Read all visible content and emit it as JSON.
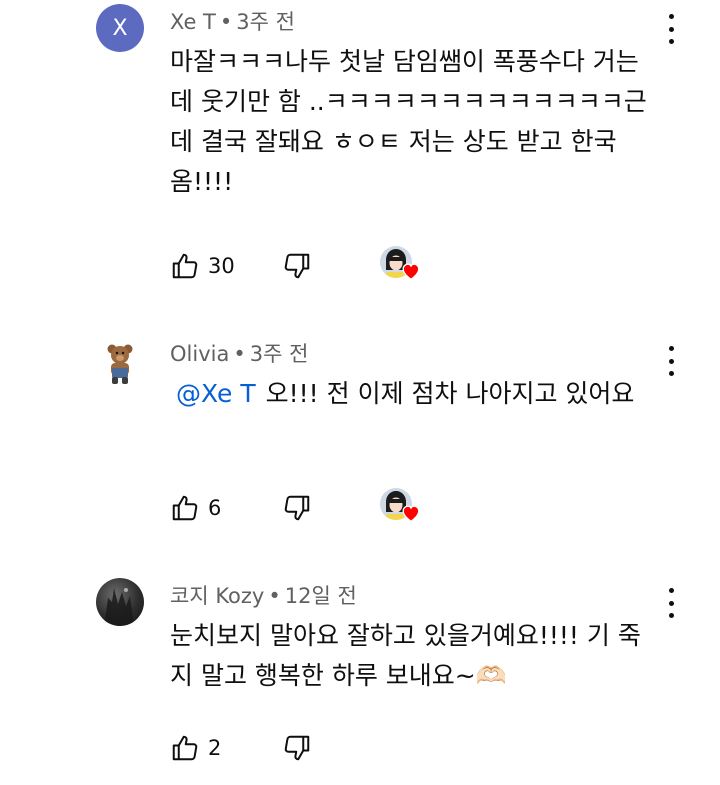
{
  "comments": [
    {
      "avatar_letter": "X",
      "author": "Xe T",
      "separator": "•",
      "time": "3주 전",
      "mention": "",
      "text": "마잘ㅋㅋㅋ나두 첫날 담임쌤이 폭풍수다 거는데 웃기만 함 ..ㅋㅋㅋㅋㅋㅋㅋㅋㅋㅋㅋㅋㅋ근데 결국 잘돼요 ㅎㅇㅌ 저는 상도 받고 한국 옴!!!!",
      "likes": "30",
      "creator_hearted": true
    },
    {
      "avatar_letter": "",
      "author": "Olivia",
      "separator": "•",
      "time": "3주 전",
      "mention": "@Xe T",
      "text": "오!!! 전 이제 점차 나아지고 있어요",
      "likes": "6",
      "creator_hearted": true
    },
    {
      "avatar_letter": "",
      "author": "코지 Kozy",
      "separator": "•",
      "time": "12일 전",
      "mention": "",
      "text": "눈치보지 말아요 잘하고 있을거예요!!!! 기 죽지 말고 행복한 하루 보내요~🫶🏻",
      "likes": "2",
      "creator_hearted": false
    }
  ],
  "icons": {
    "like": "thumbs-up-icon",
    "dislike": "thumbs-down-icon",
    "menu": "more-vert-icon",
    "heart": "heart-icon"
  },
  "colors": {
    "avatar_bg": "#5c6bc0",
    "mention": "#065fd4",
    "heart": "#ff0000",
    "meta_text": "#606060"
  }
}
